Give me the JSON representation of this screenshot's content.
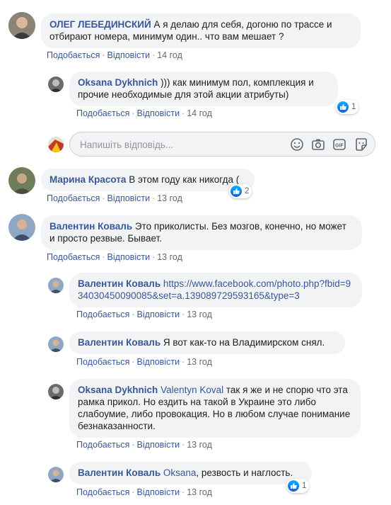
{
  "comments": [
    {
      "author": "ОЛЕГ ЛЕБЕДИНСКИЙ",
      "text": "А я делаю для себя, догоню по трассе и отбирают номера, минимум один.. что вам мешает ?",
      "like": "Подобається",
      "reply": "Відповісти",
      "time": "14 год"
    },
    {
      "author": "Oksana Dykhnich",
      "text": "))) как минимум пол, комплекция и прочие необходимые для этой акции атрибуты)",
      "like": "Подобається",
      "reply": "Відповісти",
      "time": "14 год",
      "reactions": "1"
    },
    {
      "author": "Марина Красота",
      "text": "В этом году как никогда (",
      "like": "Подобається",
      "reply": "Відповісти",
      "time": "13 год",
      "reactions": "2"
    },
    {
      "author": "Валентин Коваль",
      "text": "Это приколисты. Без мозгов, конечно, но может и просто резвые. Бывает.",
      "like": "Подобається",
      "reply": "Відповісти",
      "time": "13 год"
    },
    {
      "author": "Валентин Коваль",
      "text": "https://www.facebook.com/photo.php?fbid=934030450090085&set=a.139089729593165&type=3",
      "like": "Подобається",
      "reply": "Відповісти",
      "time": "13 год"
    },
    {
      "author": "Валентин Коваль",
      "text": "Я вот как-то на Владимирском снял.",
      "like": "Подобається",
      "reply": "Відповісти",
      "time": "13 год"
    },
    {
      "author": "Oksana Dykhnich",
      "mention": "Valentyn Koval",
      "text": "так я же и не спорю что эта рамка прикол. Но ездить на такой в Украине это либо слабоумие, либо провокация. Но в любом случае понимание безнаказанности.",
      "like": "Подобається",
      "reply": "Відповісти",
      "time": "13 год"
    },
    {
      "author": "Валентин Коваль",
      "mention": "Oksana",
      "text": ", резвость и наглость.",
      "like": "Подобається",
      "reply": "Відповісти",
      "time": "13 год",
      "reactions": "1"
    }
  ],
  "reply_box": {
    "placeholder": "Напишіть відповідь...",
    "icons": [
      "emoji-icon",
      "camera-icon",
      "gif-icon",
      "sticker-icon"
    ]
  },
  "colors": {
    "link": "#385898",
    "bubble": "#f2f3f5",
    "meta": "#606770",
    "like_blue": "#1877f2"
  }
}
